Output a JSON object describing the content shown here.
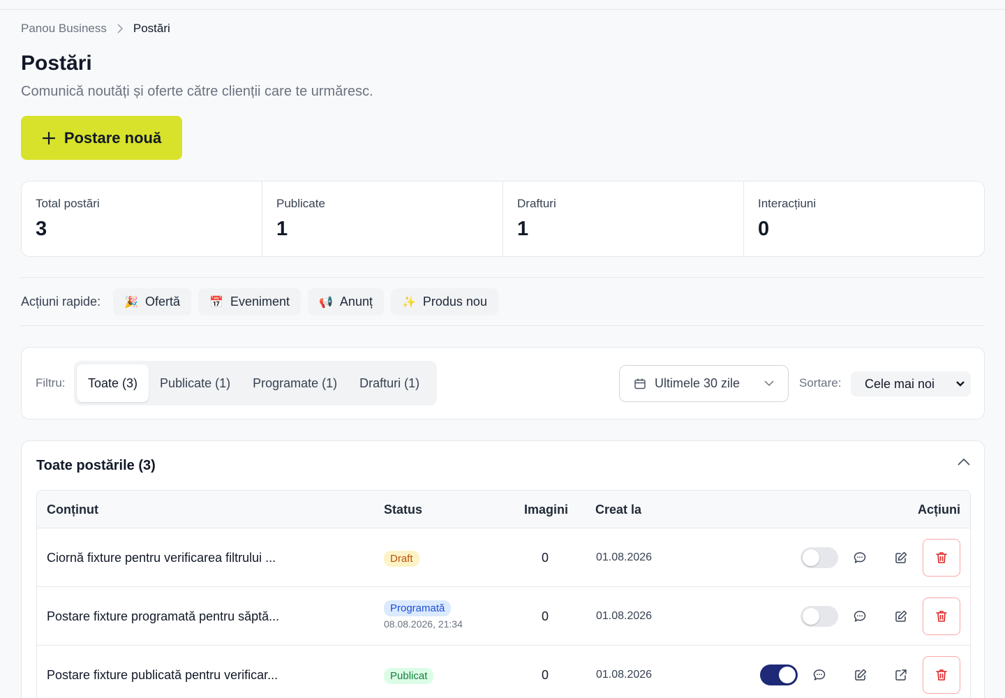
{
  "breadcrumb": {
    "parent": "Panou Business",
    "current": "Postări"
  },
  "page": {
    "title": "Postări",
    "subtitle": "Comunică noutăți și oferte către clienții care te urmăresc.",
    "new_post_label": "Postare nouă"
  },
  "stats": [
    {
      "label": "Total postări",
      "value": "3"
    },
    {
      "label": "Publicate",
      "value": "1"
    },
    {
      "label": "Drafturi",
      "value": "1"
    },
    {
      "label": "Interacțiuni",
      "value": "0"
    }
  ],
  "quick_actions": {
    "label": "Acțiuni rapide:",
    "items": [
      {
        "label": "Ofertă",
        "icon": "🎉"
      },
      {
        "label": "Eveniment",
        "icon": "📅"
      },
      {
        "label": "Anunț",
        "icon": "📢"
      },
      {
        "label": "Produs nou",
        "icon": "✨"
      }
    ]
  },
  "filter": {
    "label": "Filtru:",
    "tabs": [
      "Toate (3)",
      "Publicate (1)",
      "Programate (1)",
      "Drafturi (1)"
    ],
    "active_tab": "Toate (3)",
    "date_range": "Ultimele 30 zile",
    "sort_label": "Sortare:",
    "sort_value": "Cele mai noi"
  },
  "posts": {
    "title": "Toate postările (3)",
    "columns": {
      "content": "Conținut",
      "status": "Status",
      "images": "Imagini",
      "created": "Creat la",
      "actions": "Acțiuni"
    },
    "rows": [
      {
        "content": "Ciornă fixture pentru verificarea filtrului ...",
        "status": "Draft",
        "scheduled": "",
        "images": "0",
        "created": "01.08.2026",
        "enabled": false
      },
      {
        "content": "Postare fixture programată pentru săptă...",
        "status": "Programată",
        "scheduled": "08.08.2026, 21:34",
        "images": "0",
        "created": "01.08.2026",
        "enabled": false
      },
      {
        "content": "Postare fixture publicată pentru verificar...",
        "status": "Publicat",
        "scheduled": "",
        "images": "0",
        "created": "01.08.2026",
        "enabled": true
      }
    ]
  },
  "colors": {
    "accent": "#d8e22a",
    "toggle_on": "#1e2a78",
    "danger": "#dc2626"
  }
}
